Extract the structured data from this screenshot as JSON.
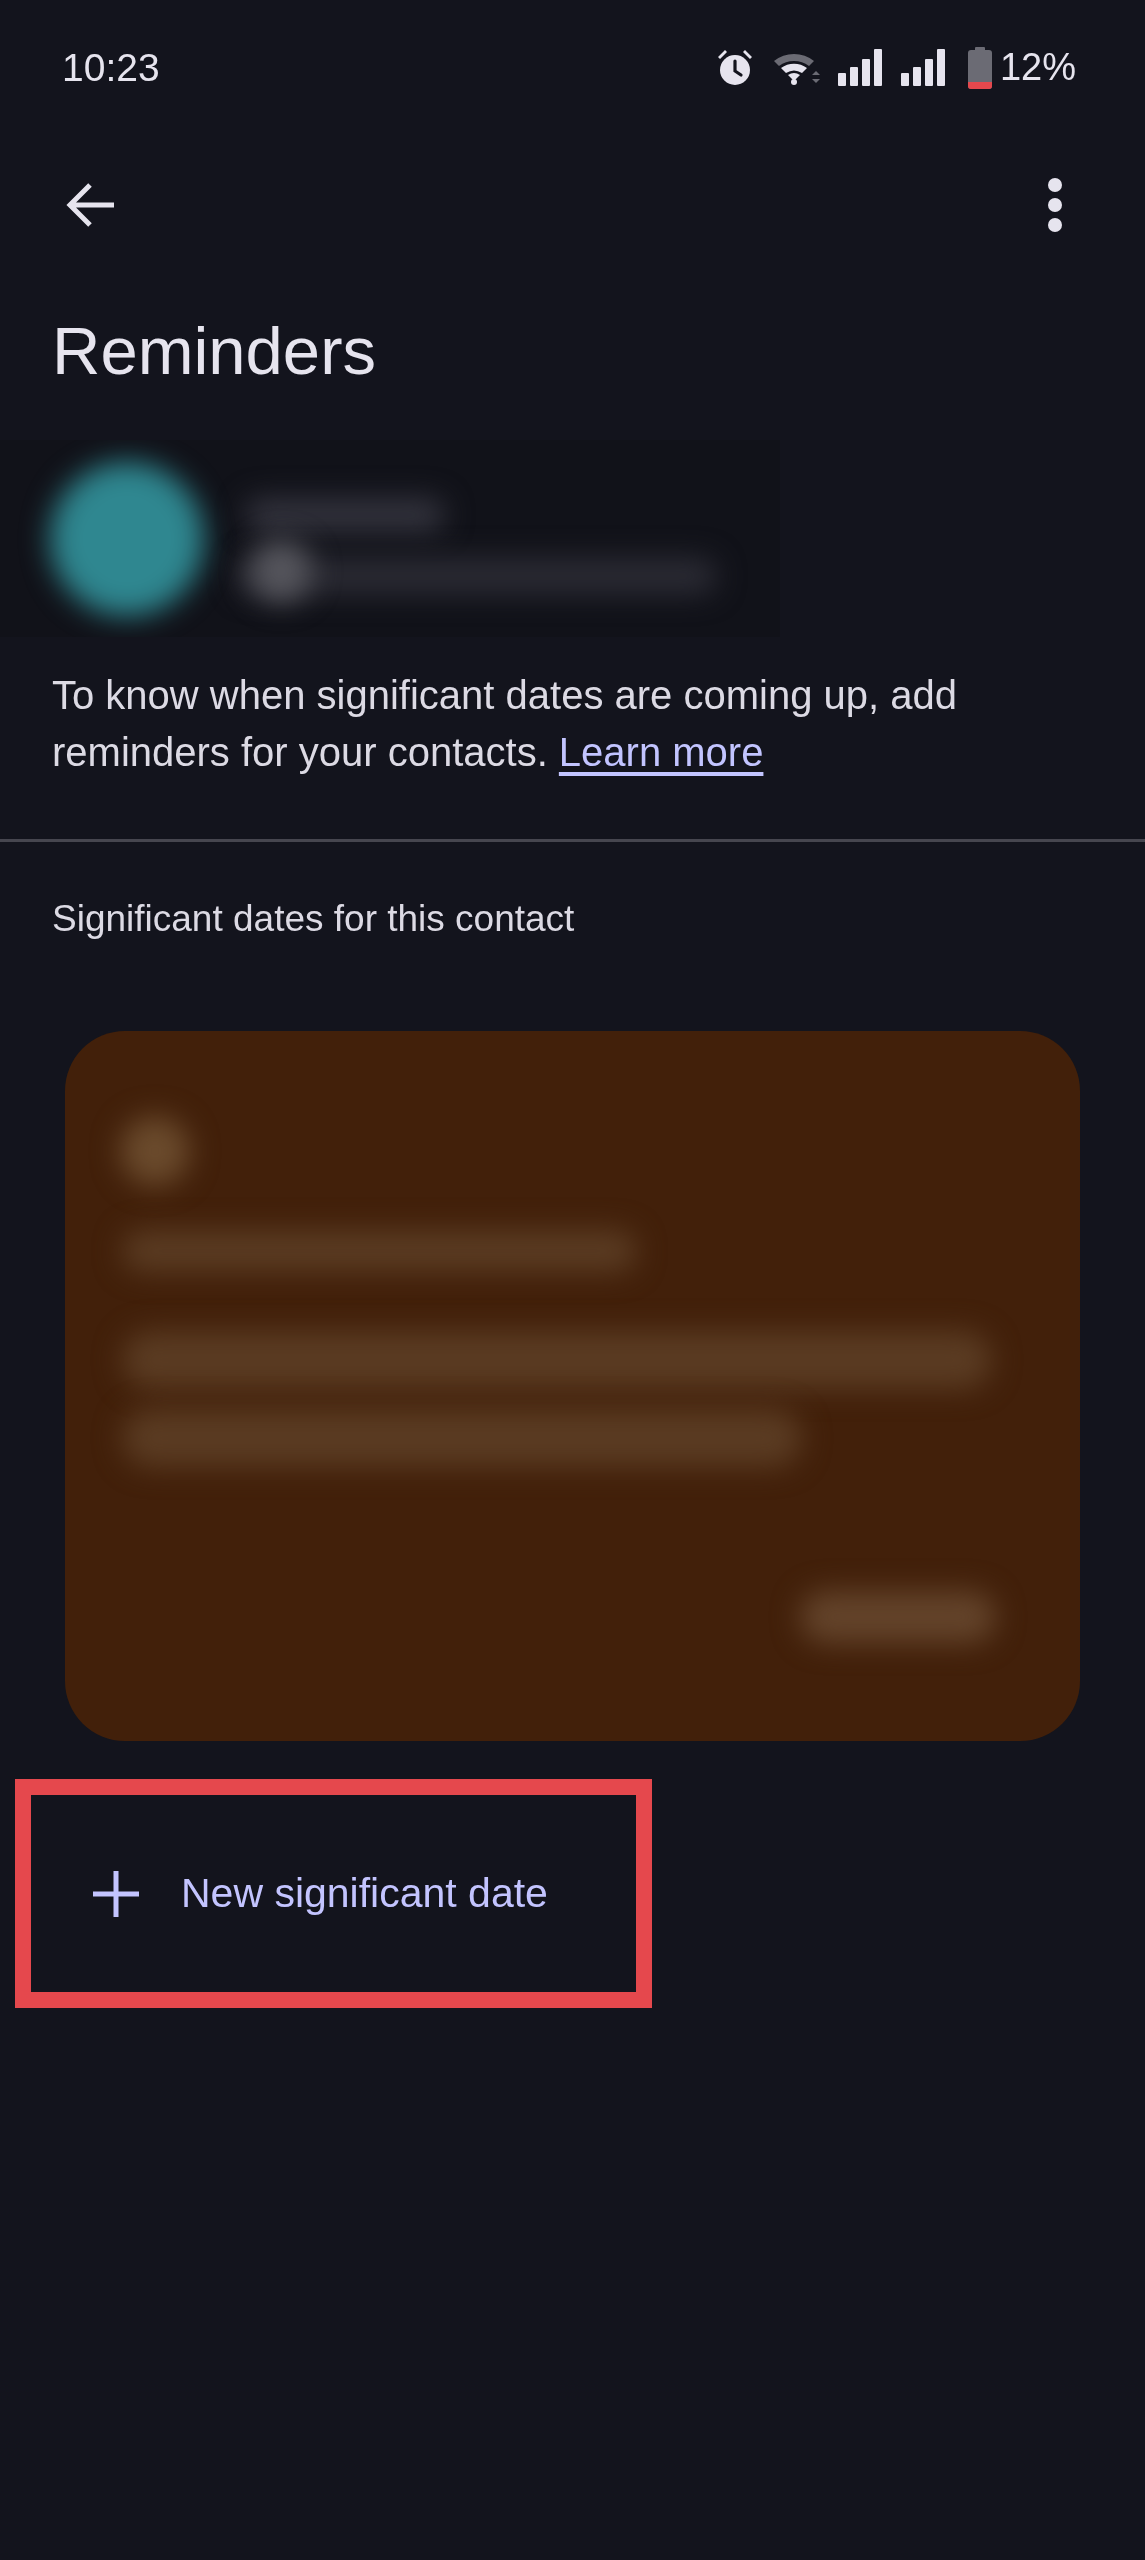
{
  "status_bar": {
    "time": "10:23",
    "battery": "12%"
  },
  "app_bar": {
    "title": "Reminders"
  },
  "description": {
    "text": "To know when significant dates are coming up, add reminders for your contacts.",
    "link": "Learn more"
  },
  "section": {
    "title": "Significant dates for this contact"
  },
  "add_button": {
    "label": "New significant date",
    "highlighted": true
  }
}
